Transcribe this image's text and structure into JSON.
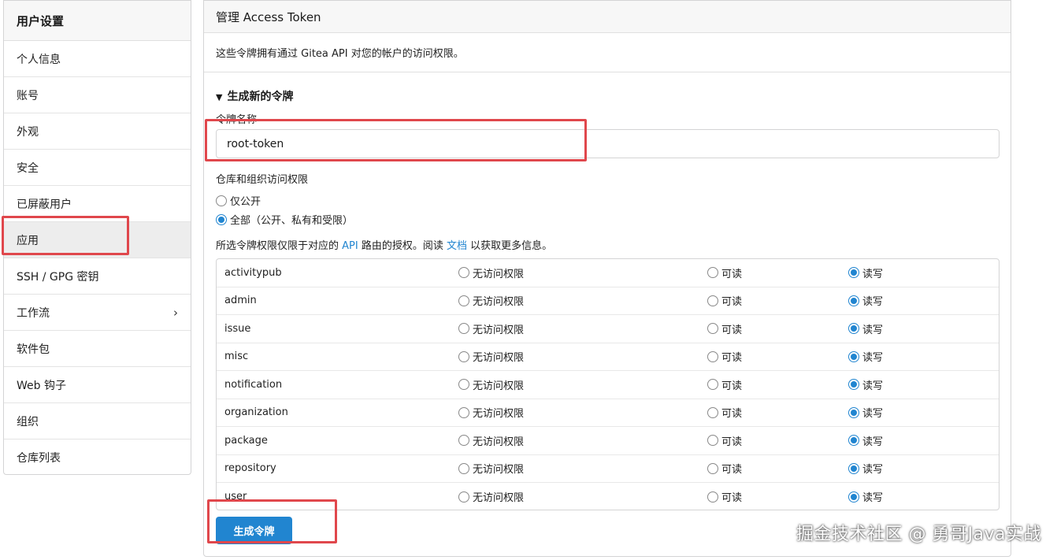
{
  "sidebar": {
    "title": "用户设置",
    "items": [
      {
        "label": "个人信息"
      },
      {
        "label": "账号"
      },
      {
        "label": "外观"
      },
      {
        "label": "安全"
      },
      {
        "label": "已屏蔽用户"
      },
      {
        "label": "应用",
        "active": true
      },
      {
        "label": "SSH / GPG 密钥"
      },
      {
        "label": "工作流",
        "chevron": "›"
      },
      {
        "label": "软件包"
      },
      {
        "label": "Web 钩子"
      },
      {
        "label": "组织"
      },
      {
        "label": "仓库列表"
      }
    ]
  },
  "panel": {
    "title": "管理 Access Token",
    "description": "这些令牌拥有通过 Gitea API 对您的帐户的访问权限。",
    "section_title": "生成新的令牌",
    "section_toggle": "▼",
    "token_name_label": "令牌名称",
    "token_name_value": "root-token",
    "repo_access_label": "仓库和组织访问权限",
    "repo_access_options": [
      {
        "label": "仅公开",
        "selected": false
      },
      {
        "label": "全部（公开、私有和受限）",
        "selected": true
      }
    ],
    "hint_before": "所选令牌权限仅限于对应的 ",
    "hint_link1": "API",
    "hint_middle": " 路由的授权。阅读 ",
    "hint_link2": "文档",
    "hint_after": " 以获取更多信息。",
    "permission_options": [
      "无访问权限",
      "可读",
      "读写"
    ],
    "permissions": [
      {
        "name": "activitypub",
        "selected": 2
      },
      {
        "name": "admin",
        "selected": 2
      },
      {
        "name": "issue",
        "selected": 2
      },
      {
        "name": "misc",
        "selected": 2
      },
      {
        "name": "notification",
        "selected": 2
      },
      {
        "name": "organization",
        "selected": 2
      },
      {
        "name": "package",
        "selected": 2
      },
      {
        "name": "repository",
        "selected": 2
      },
      {
        "name": "user",
        "selected": 2
      }
    ],
    "generate_button": "生成令牌"
  },
  "watermark": "掘金技术社区 @ 勇哥Java实战",
  "colors": {
    "accent": "#2185d0",
    "annotation": "#e0474c"
  }
}
